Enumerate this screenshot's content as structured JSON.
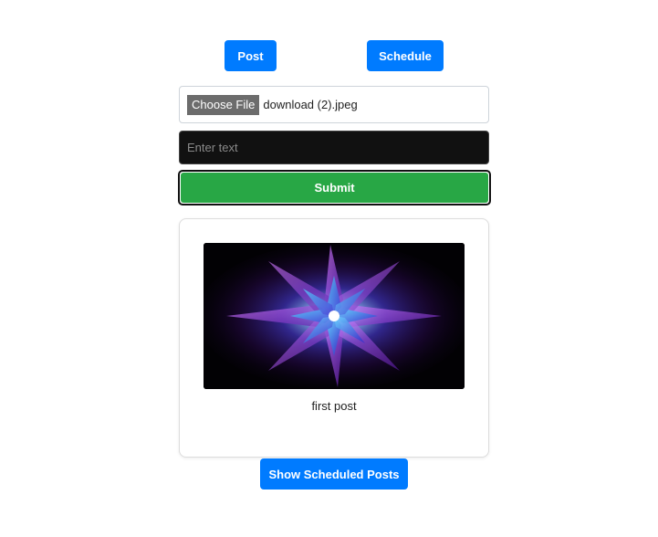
{
  "top_buttons": {
    "post_label": "Post",
    "schedule_label": "Schedule"
  },
  "file_input": {
    "button_label": "Choose File",
    "file_name": "download (2).jpeg"
  },
  "text_input": {
    "value": "",
    "placeholder": "Enter text"
  },
  "submit": {
    "label": "Submit"
  },
  "post_card": {
    "caption": "first post"
  },
  "show_scheduled": {
    "label": "Show Scheduled Posts"
  },
  "colors": {
    "primary": "#007bff",
    "success": "#28a745",
    "input_dark": "#111111"
  }
}
